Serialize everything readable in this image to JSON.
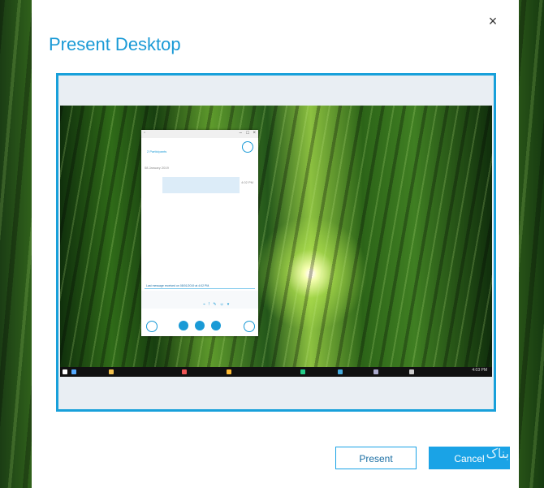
{
  "dialog": {
    "title": "Present Desktop",
    "close_glyph": "×",
    "buttons": {
      "present_label": "Present",
      "cancel_label": "Cancel"
    }
  },
  "preview": {
    "chat_window": {
      "participants_label": "2 Participants",
      "date_label": "08 January 2019",
      "message_time": "4:02 PM",
      "last_message_label": "Last message received on 08/01/2019 at 4:02 PM."
    },
    "taskbar_time": "4:03 PM"
  },
  "watermark": {
    "text": "تابناک"
  },
  "colors": {
    "accent": "#1aa3e6",
    "title": "#1a9ad6"
  }
}
